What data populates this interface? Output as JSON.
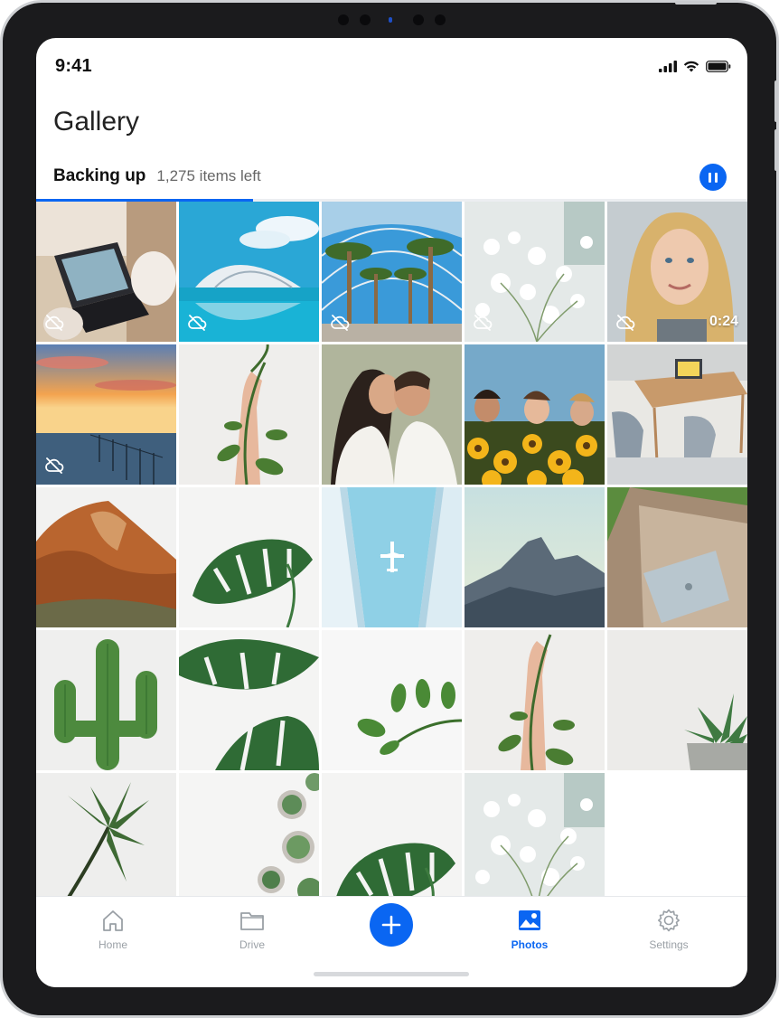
{
  "status_bar": {
    "time": "9:41"
  },
  "header": {
    "title": "Gallery"
  },
  "backup": {
    "label": "Backing up",
    "items_left": "1,275 items left",
    "progress": 0.305
  },
  "colors": {
    "accent": "#0a66f2",
    "inactive": "#9aa0a6"
  },
  "gallery": {
    "tiles": [
      {
        "subject": "laptop-typing",
        "not_backed_up": true
      },
      {
        "subject": "futuristic-building-water",
        "not_backed_up": true
      },
      {
        "subject": "palm-trees-arcade",
        "not_backed_up": true
      },
      {
        "subject": "white-flowers",
        "not_backed_up": true
      },
      {
        "subject": "portrait-video",
        "not_backed_up": true,
        "duration": "0:24"
      },
      {
        "subject": "sunset-sea",
        "not_backed_up": true
      },
      {
        "subject": "hand-holding-plant"
      },
      {
        "subject": "couple"
      },
      {
        "subject": "friends-sunflowers"
      },
      {
        "subject": "dining-table-tablet"
      },
      {
        "subject": "red-rock-cliff"
      },
      {
        "subject": "monstera-leaf"
      },
      {
        "subject": "airplane-between-buildings"
      },
      {
        "subject": "mountain-peak"
      },
      {
        "subject": "laptop-on-ledge"
      },
      {
        "subject": "cactus"
      },
      {
        "subject": "monstera-leaves"
      },
      {
        "subject": "leaf-sprig"
      },
      {
        "subject": "hand-holding-plant"
      },
      {
        "subject": "succulent-pot"
      },
      {
        "subject": "palm-leaf"
      },
      {
        "subject": "succulents-topview"
      },
      {
        "subject": "monstera-leaf"
      },
      {
        "subject": "white-flowers"
      }
    ]
  },
  "tabbar": {
    "items": [
      {
        "label": "Home",
        "icon": "home-icon",
        "active": false
      },
      {
        "label": "Drive",
        "icon": "folder-icon",
        "active": false
      },
      {
        "label": "",
        "icon": "plus-icon",
        "active": false
      },
      {
        "label": "Photos",
        "icon": "photos-icon",
        "active": true
      },
      {
        "label": "Settings",
        "icon": "gear-icon",
        "active": false
      }
    ]
  }
}
